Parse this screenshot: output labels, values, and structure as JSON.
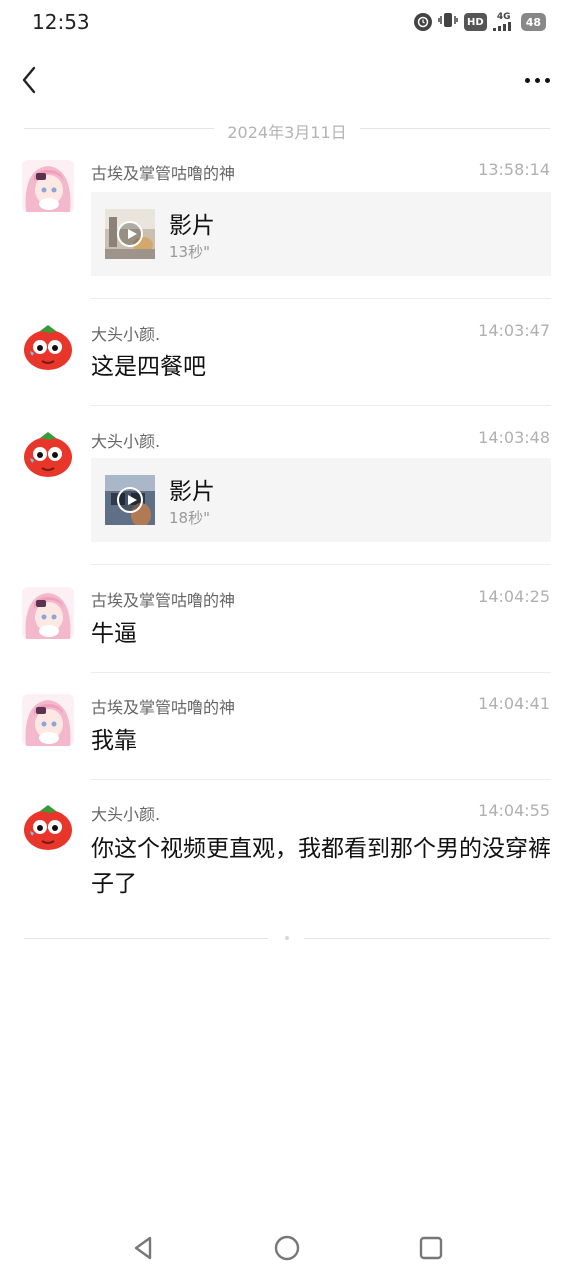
{
  "status_bar": {
    "time": "12:53",
    "icons": [
      "alarm-icon",
      "vibrate-icon",
      "hd-icon",
      "signal-4g-icon",
      "battery-icon"
    ],
    "hd_label": "HD",
    "network_label": "4G",
    "battery_level": "48"
  },
  "header": {
    "back_icon": "chevron-left-icon",
    "more_icon": "more-dots-icon"
  },
  "date_divider": "2024年3月11日",
  "messages": [
    {
      "sender": "古埃及掌管咕噜的神",
      "time": "13:58:14",
      "type": "video",
      "avatar": "anime-girl",
      "video_title": "影片",
      "video_duration": "13秒\""
    },
    {
      "sender": "大头小颜.",
      "time": "14:03:47",
      "type": "text",
      "avatar": "tomato",
      "text": "这是四餐吧"
    },
    {
      "sender": "大头小颜.",
      "time": "14:03:48",
      "type": "video",
      "avatar": "tomato",
      "video_title": "影片",
      "video_duration": "18秒\""
    },
    {
      "sender": "古埃及掌管咕噜的神",
      "time": "14:04:25",
      "type": "text",
      "avatar": "anime-girl",
      "text": "牛逼"
    },
    {
      "sender": "古埃及掌管咕噜的神",
      "time": "14:04:41",
      "type": "text",
      "avatar": "anime-girl",
      "text": "我靠"
    },
    {
      "sender": "大头小颜.",
      "time": "14:04:55",
      "type": "text",
      "avatar": "tomato",
      "text": "你这个视频更直观，我都看到那个男的没穿裤子了"
    }
  ],
  "system_nav": [
    "back-triangle-icon",
    "home-circle-icon",
    "recents-square-icon"
  ],
  "colors": {
    "background": "#ffffff",
    "card": "#f5f5f5",
    "meta_text": "#b0b0b0",
    "tomato_red": "#e8362b"
  }
}
